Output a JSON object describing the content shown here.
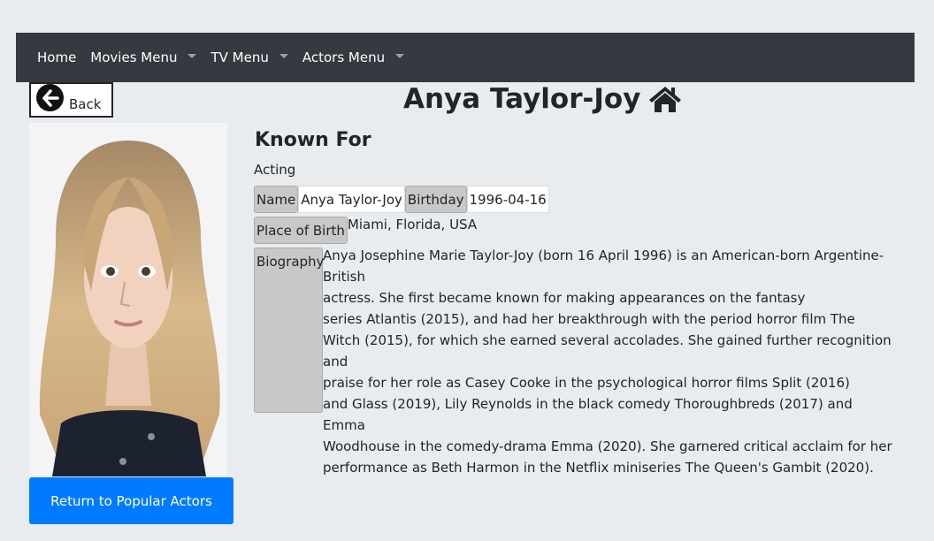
{
  "nav": {
    "items": [
      {
        "label": "Home",
        "dropdown": false
      },
      {
        "label": "Movies Menu",
        "dropdown": true
      },
      {
        "label": "TV Menu",
        "dropdown": true
      },
      {
        "label": "Actors Menu",
        "dropdown": true
      }
    ]
  },
  "back_button": {
    "label": "Back",
    "icon": "arrow-left-circle-icon"
  },
  "page": {
    "title": "Anya Taylor-Joy",
    "title_icon": "home-icon"
  },
  "actor": {
    "photo_icon": "portrait-photo",
    "known_for_heading": "Known For",
    "department": "Acting",
    "name_label": "Name",
    "name_value": "Anya Taylor-Joy",
    "birthday_label": "Birthday",
    "birthday_value": "1996-04-16",
    "place_label": "Place of Birth",
    "place_value": "Miami, Florida, USA",
    "bio_label": "Biography",
    "bio_lines": [
      "Anya Josephine Marie Taylor-Joy (born 16 April 1996) is an American-born Argentine-British",
      "actress. She first became known for making appearances on the fantasy",
      "series Atlantis (2015), and had her breakthrough with the period horror film The",
      "Witch (2015), for which she earned several accolades. She gained further recognition and",
      "praise for her role as Casey Cooke in the psychological horror films Split (2016)",
      "and Glass (2019), Lily Reynolds in the black comedy Thoroughbreds (2017) and Emma",
      "Woodhouse in the comedy-drama Emma (2020). She garnered critical acclaim for her",
      "performance as Beth Harmon in the Netflix miniseries The Queen's Gambit (2020)."
    ]
  },
  "return_button": {
    "label": "Return to Popular Actors"
  },
  "colors": {
    "nav_bg": "#343a40",
    "primary": "#007bff",
    "label_bg": "#c8c8c8",
    "page_bg": "#e9ecef"
  }
}
